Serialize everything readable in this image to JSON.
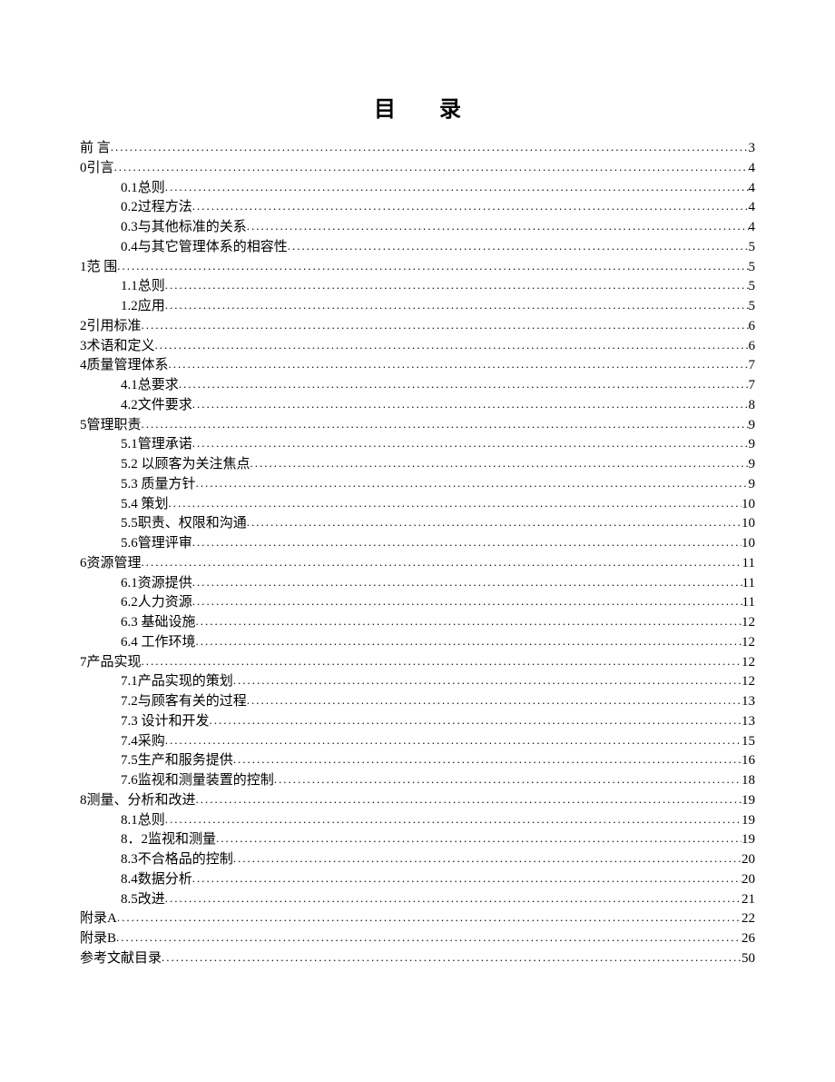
{
  "title": "目录",
  "entries": [
    {
      "label": "前  言",
      "page": "3",
      "level": 1
    },
    {
      "label": "0引言",
      "page": "4",
      "level": 1
    },
    {
      "label": "0.1总则",
      "page": "4",
      "level": 2
    },
    {
      "label": "0.2过程方法",
      "page": "4",
      "level": 2
    },
    {
      "label": "0.3与其他标准的关系",
      "page": "4",
      "level": 2
    },
    {
      "label": "0.4与其它管理体系的相容性",
      "page": "5",
      "level": 2
    },
    {
      "label": "1范 围",
      "page": "5",
      "level": 1
    },
    {
      "label": "1.1总则",
      "page": "5",
      "level": 2
    },
    {
      "label": "1.2应用",
      "page": "5",
      "level": 2
    },
    {
      "label": "2引用标准",
      "page": "6",
      "level": 1
    },
    {
      "label": "3术语和定义",
      "page": "6",
      "level": 1
    },
    {
      "label": "4质量管理体系",
      "page": "7",
      "level": 1
    },
    {
      "label": "4.1总要求",
      "page": "7",
      "level": 2
    },
    {
      "label": "4.2文件要求",
      "page": "8",
      "level": 2
    },
    {
      "label": "5管理职责",
      "page": "9",
      "level": 1
    },
    {
      "label": "5.1管理承诺",
      "page": "9",
      "level": 2
    },
    {
      "label": "5.2 以顾客为关注焦点",
      "page": "9",
      "level": 2
    },
    {
      "label": "5.3 质量方针",
      "page": "9",
      "level": 2
    },
    {
      "label": "5.4 策划",
      "page": "10",
      "level": 2
    },
    {
      "label": "5.5职责、权限和沟通",
      "page": "10",
      "level": 2
    },
    {
      "label": "5.6管理评审",
      "page": "10",
      "level": 2
    },
    {
      "label": "6资源管理",
      "page": "11",
      "level": 1
    },
    {
      "label": "6.1资源提供",
      "page": "11",
      "level": 2
    },
    {
      "label": "6.2人力资源",
      "page": "11",
      "level": 2
    },
    {
      "label": "6.3  基础设施",
      "page": "12",
      "level": 2
    },
    {
      "label": "6.4  工作环境",
      "page": "12",
      "level": 2
    },
    {
      "label": "7产品实现",
      "page": "12",
      "level": 1
    },
    {
      "label": "7.1产品实现的策划",
      "page": "12",
      "level": 2
    },
    {
      "label": "7.2与顾客有关的过程",
      "page": "13",
      "level": 2
    },
    {
      "label": "7.3  设计和开发",
      "page": "13",
      "level": 2
    },
    {
      "label": "7.4采购",
      "page": "15",
      "level": 2
    },
    {
      "label": "7.5生产和服务提供",
      "page": "16",
      "level": 2
    },
    {
      "label": "7.6监视和测量装置的控制",
      "page": "18",
      "level": 2
    },
    {
      "label": "8测量、分析和改进",
      "page": "19",
      "level": 1
    },
    {
      "label": "8.1总则",
      "page": "19",
      "level": 2
    },
    {
      "label": "8．2监视和测量",
      "page": "19",
      "level": 2
    },
    {
      "label": "8.3不合格品的控制",
      "page": "20",
      "level": 2
    },
    {
      "label": "8.4数据分析",
      "page": "20",
      "level": 2
    },
    {
      "label": "8.5改进",
      "page": "21",
      "level": 2
    },
    {
      "label": "附录A",
      "page": "22",
      "level": 1
    },
    {
      "label": "附录B",
      "page": "26",
      "level": 1
    },
    {
      "label": "参考文献目录",
      "page": "50",
      "level": 1
    }
  ]
}
